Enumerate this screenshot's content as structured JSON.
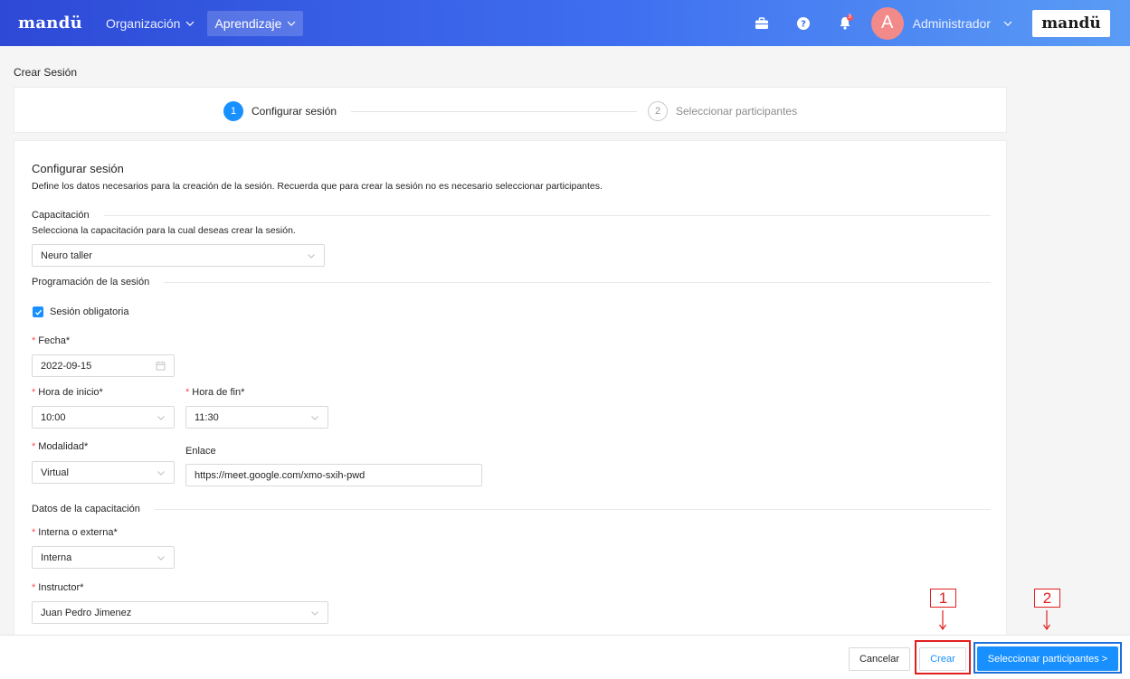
{
  "topbar": {
    "brand": "mandü",
    "nav": [
      {
        "label": "Organización",
        "active": false
      },
      {
        "label": "Aprendizaje",
        "active": true
      }
    ],
    "icons": [
      "briefcase-icon",
      "help-icon",
      "bell-icon"
    ],
    "notification_count": "3",
    "avatar_initial": "A",
    "user_name": "Administrador",
    "brand_box": "mandü"
  },
  "page": {
    "title": "Crear Sesión"
  },
  "steps": [
    {
      "number": "1",
      "label": "Configurar sesión",
      "status": "active"
    },
    {
      "number": "2",
      "label": "Seleccionar participantes",
      "status": "pending"
    }
  ],
  "form": {
    "title": "Configurar sesión",
    "description": "Define los datos necesarios para la creación de la sesión. Recuerda que para crear la sesión no es necesario seleccionar participantes.",
    "capacitacion_section": "Capacitación",
    "capacitacion_hint": "Selecciona la capacitación para la cual deseas crear la sesión.",
    "capacitacion_value": "Neuro taller",
    "programacion_section": "Programación de la sesión",
    "obligatoria_label": "Sesión obligatoria",
    "obligatoria_checked": true,
    "fecha_label": "Fecha*",
    "fecha_value": "2022-09-15",
    "hora_inicio_label": "Hora de inicio*",
    "hora_inicio_value": "10:00",
    "hora_fin_label": "Hora de fin*",
    "hora_fin_value": "11:30",
    "modalidad_label": "Modalidad*",
    "modalidad_value": "Virtual",
    "enlace_label": "Enlace",
    "enlace_value": "https://meet.google.com/xmo-sxih-pwd",
    "datos_section": "Datos de la capacitación",
    "interna_label": "Interna o externa*",
    "interna_value": "Interna",
    "instructor_label": "Instructor*",
    "instructor_value": "Juan Pedro Jimenez",
    "required_mark": "*"
  },
  "footer": {
    "cancel_label": "Cancelar",
    "create_label": "Crear",
    "next_label": "Seleccionar participantes >"
  },
  "annotations": [
    "1",
    "2"
  ],
  "colors": {
    "primary": "#1890ff",
    "annotation_red": "#e02020",
    "annotation_blue": "#1e6fd9",
    "required": "#ff4d4f"
  }
}
